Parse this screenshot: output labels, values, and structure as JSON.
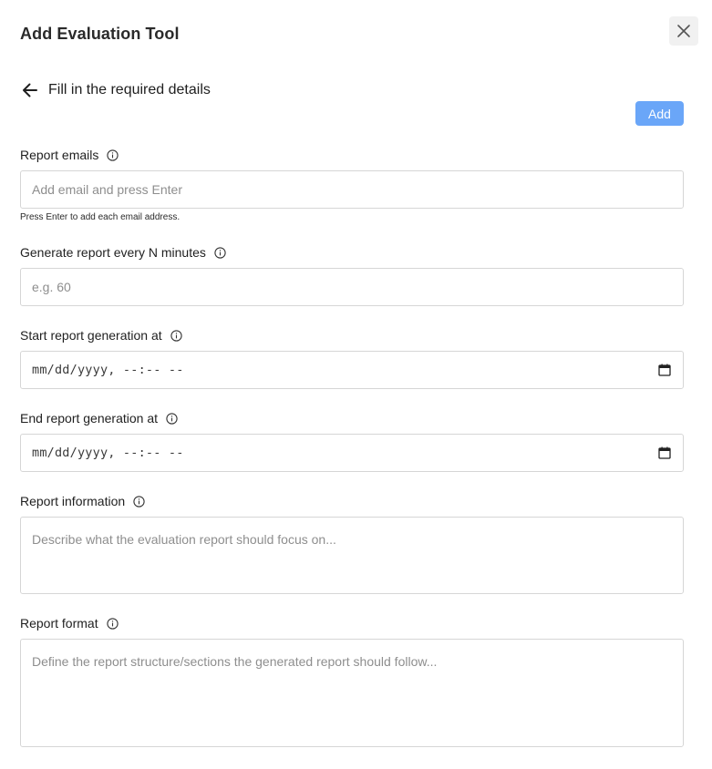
{
  "dialog": {
    "title": "Add Evaluation Tool",
    "subtitle": "Fill in the required details",
    "add_label": "Add"
  },
  "fields": {
    "report_emails": {
      "label": "Report emails",
      "placeholder": "Add email and press Enter",
      "helper": "Press Enter to add each email address."
    },
    "interval": {
      "label": "Generate report every N minutes",
      "placeholder": "e.g. 60"
    },
    "start": {
      "label": "Start report generation at",
      "value": "mm/dd/yyyy, --:-- --"
    },
    "end": {
      "label": "End report generation at",
      "value": "mm/dd/yyyy, --:-- --"
    },
    "info": {
      "label": "Report information",
      "placeholder": "Describe what the evaluation report should focus on..."
    },
    "format": {
      "label": "Report format",
      "placeholder": "Define the report structure/sections the generated report should follow..."
    }
  },
  "icons": {
    "close": "close-icon",
    "back": "arrow-left-icon",
    "info": "info-icon",
    "calendar": "calendar-icon"
  },
  "colors": {
    "accent": "#6aa6f8",
    "border": "#d6d6d6",
    "placeholder": "#8e8e8e"
  }
}
